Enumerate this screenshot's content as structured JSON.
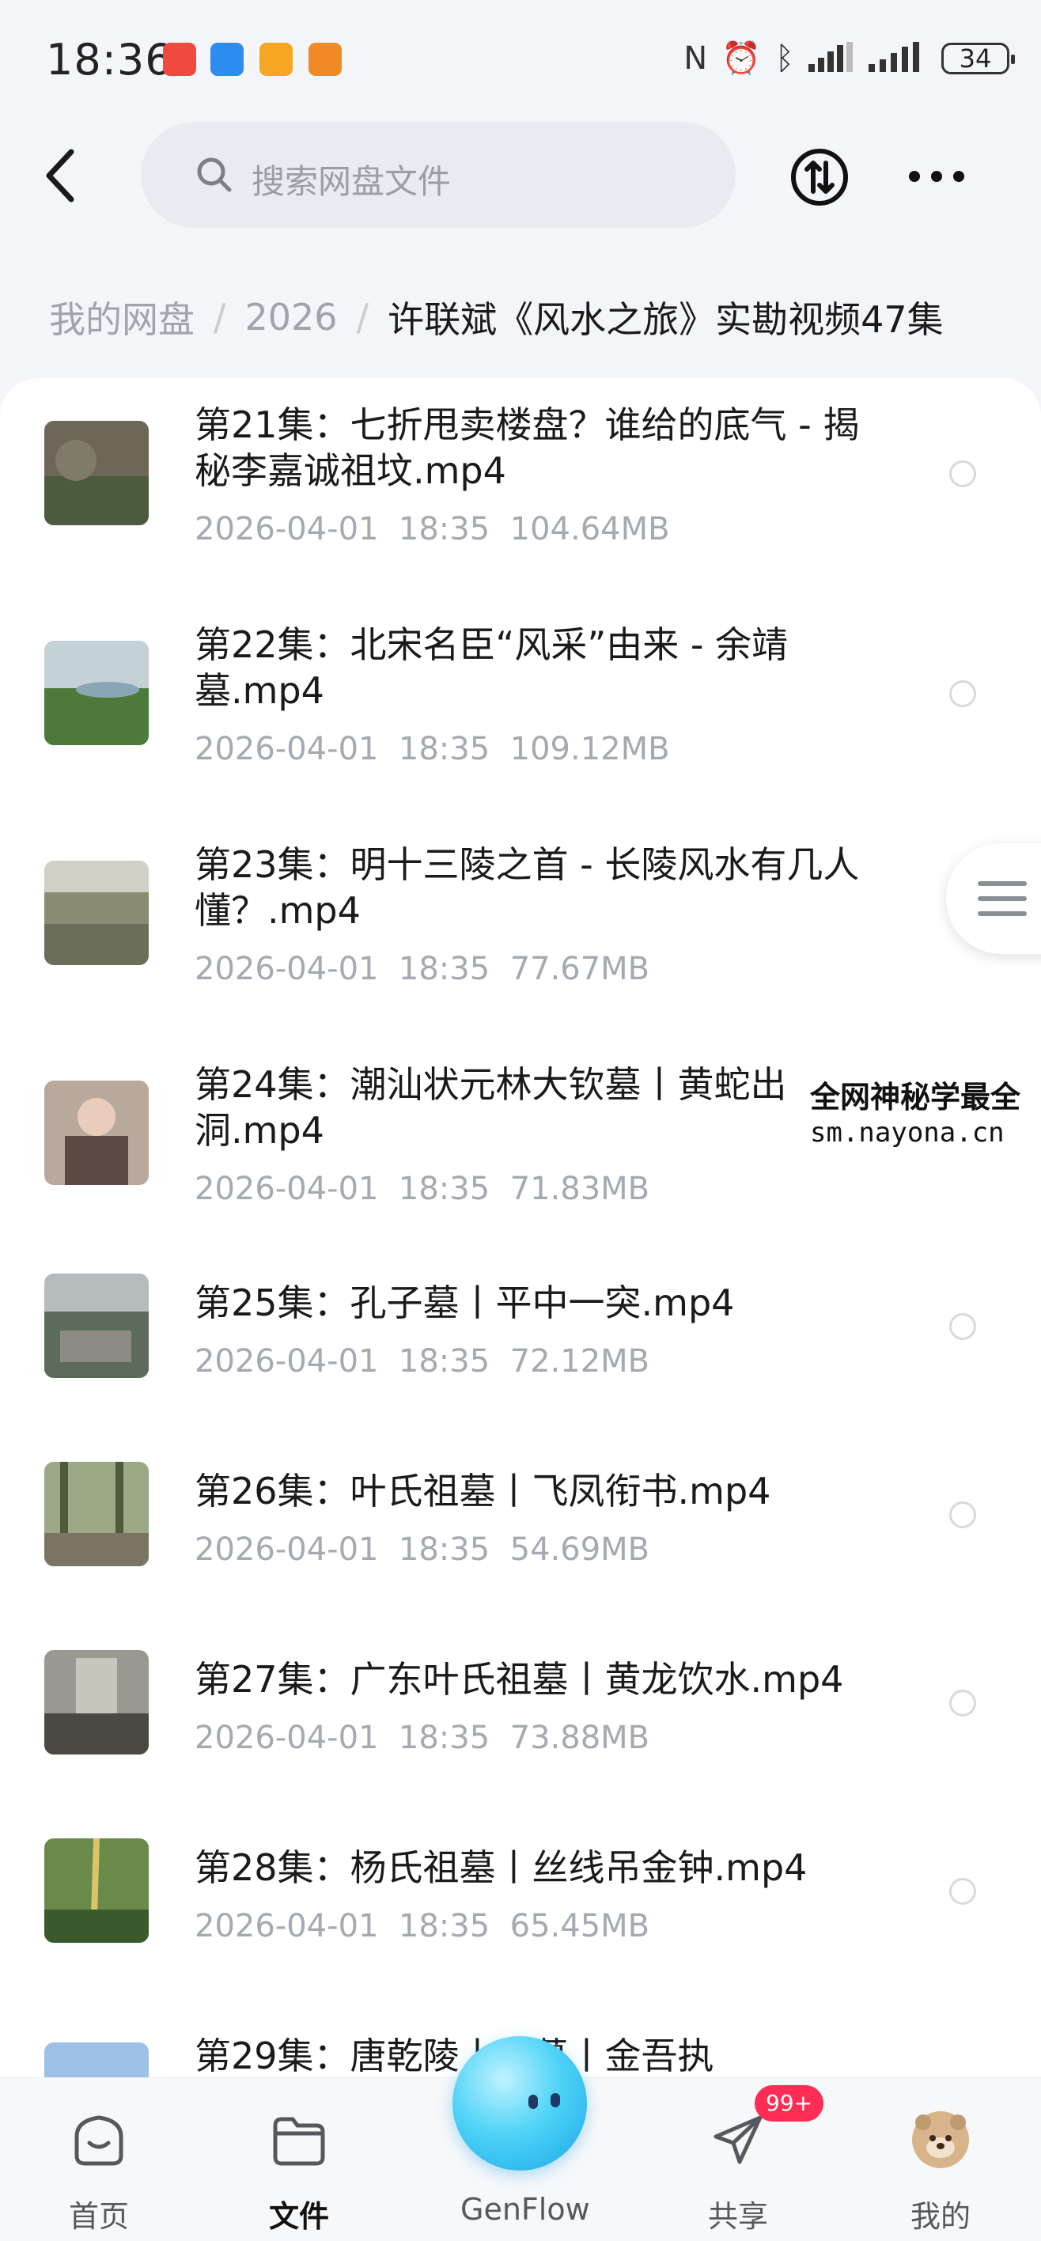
{
  "status_bar": {
    "time": "18:36",
    "battery": "34",
    "app_icons": [
      {
        "name": "red-app-icon",
        "color": "#f04a3e"
      },
      {
        "name": "weather-app-icon",
        "color": "#2d8cf0"
      },
      {
        "name": "video-app-icon",
        "color": "#f5a623"
      },
      {
        "name": "orange-app-icon",
        "color": "#f08a24"
      }
    ]
  },
  "search": {
    "placeholder": "搜索网盘文件"
  },
  "breadcrumb": {
    "items": [
      "我的网盘",
      "2026"
    ],
    "current": "许联斌《风水之旅》实勘视频47集"
  },
  "files": [
    {
      "name": "第21集：七折甩卖楼盘？谁给的底气 - 揭秘李嘉诚祖坟.mp4",
      "date": "2026-04-01",
      "time": "18:35",
      "size": "104.64MB",
      "thumb_colors": [
        "#6e6658",
        "#4c5a3e"
      ]
    },
    {
      "name": "第22集：北宋名臣“风采”由来 - 余靖墓.mp4",
      "date": "2026-04-01",
      "time": "18:35",
      "size": "109.12MB",
      "thumb_colors": [
        "#b9c9cf",
        "#4c7a3a"
      ]
    },
    {
      "name": "第23集：明十三陵之首 - 长陵风水有几人懂？.mp4",
      "date": "2026-04-01",
      "time": "18:35",
      "size": "77.67MB",
      "thumb_colors": [
        "#c6c3ba",
        "#6b6f5a"
      ]
    },
    {
      "name": "第24集：潮汕状元林大钦墓丨黄蛇出洞.mp4",
      "date": "2026-04-01",
      "time": "18:35",
      "size": "71.83MB",
      "thumb_colors": [
        "#b9a89c",
        "#5b4a44"
      ]
    },
    {
      "name": "第25集：孔子墓丨平中一突.mp4",
      "date": "2026-04-01",
      "time": "18:35",
      "size": "72.12MB",
      "thumb_colors": [
        "#a9b0b2",
        "#5d6b5a"
      ]
    },
    {
      "name": "第26集：叶氏祖墓丨飞凤衔书.mp4",
      "date": "2026-04-01",
      "time": "18:35",
      "size": "54.69MB",
      "thumb_colors": [
        "#9aa886",
        "#4e5a3c"
      ]
    },
    {
      "name": "第27集：广东叶氏祖墓丨黄龙饮水.mp4",
      "date": "2026-04-01",
      "time": "18:35",
      "size": "73.88MB",
      "thumb_colors": [
        "#9a9890",
        "#4a4842"
      ]
    },
    {
      "name": "第28集：杨氏祖墓丨丝线吊金钟.mp4",
      "date": "2026-04-01",
      "time": "18:35",
      "size": "65.45MB",
      "thumb_colors": [
        "#6a8a4a",
        "#3a5a2c"
      ]
    },
    {
      "name": "第29集：唐乾陵丨乘墓丨金吾执",
      "date": "",
      "time": "",
      "size": "",
      "thumb_colors": [
        "#9cc0e6",
        "#5f8fc2"
      ]
    }
  ],
  "watermark": {
    "title": "全网神秘学最全",
    "url": "sm.nayona.cn"
  },
  "bottom_nav": {
    "home": "首页",
    "files": "文件",
    "genflow": "GenFlow",
    "share": "共享",
    "share_badge": "99+",
    "me": "我的"
  }
}
